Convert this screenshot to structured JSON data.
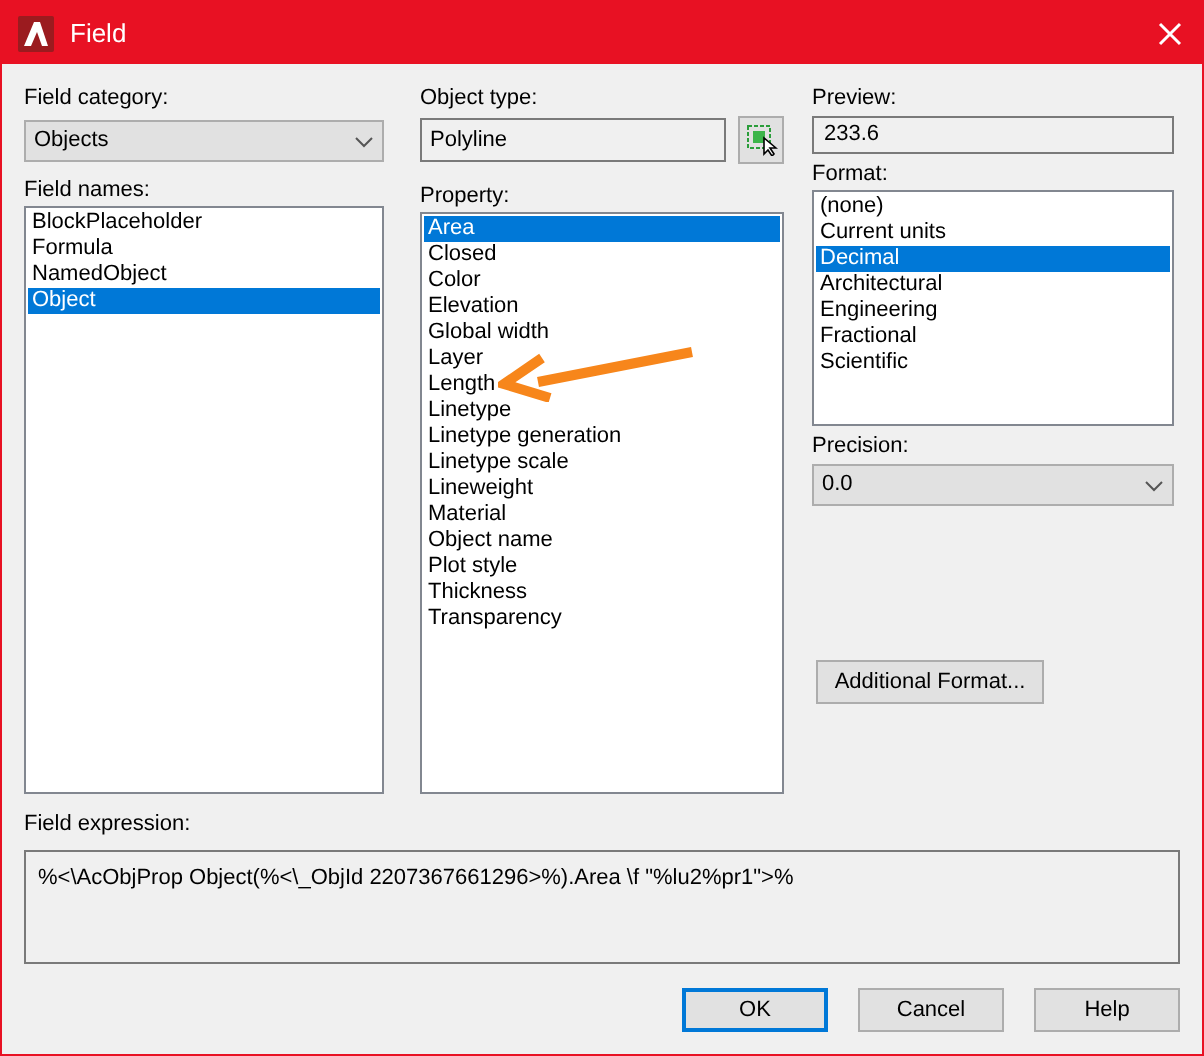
{
  "window": {
    "title": "Field"
  },
  "field_category": {
    "label": "Field category:",
    "value": "Objects"
  },
  "field_names": {
    "label": "Field names:",
    "items": [
      {
        "label": "BlockPlaceholder",
        "selected": false
      },
      {
        "label": "Formula",
        "selected": false
      },
      {
        "label": "NamedObject",
        "selected": false
      },
      {
        "label": "Object",
        "selected": true
      }
    ]
  },
  "object_type": {
    "label": "Object type:",
    "value": "Polyline"
  },
  "property": {
    "label": "Property:",
    "items": [
      {
        "label": "Area",
        "selected": true
      },
      {
        "label": "Closed",
        "selected": false
      },
      {
        "label": "Color",
        "selected": false
      },
      {
        "label": "Elevation",
        "selected": false
      },
      {
        "label": "Global width",
        "selected": false
      },
      {
        "label": "Layer",
        "selected": false
      },
      {
        "label": "Length",
        "selected": false
      },
      {
        "label": "Linetype",
        "selected": false
      },
      {
        "label": "Linetype generation",
        "selected": false
      },
      {
        "label": "Linetype scale",
        "selected": false
      },
      {
        "label": "Lineweight",
        "selected": false
      },
      {
        "label": "Material",
        "selected": false
      },
      {
        "label": "Object name",
        "selected": false
      },
      {
        "label": "Plot style",
        "selected": false
      },
      {
        "label": "Thickness",
        "selected": false
      },
      {
        "label": "Transparency",
        "selected": false
      }
    ]
  },
  "preview": {
    "label": "Preview:",
    "value": "233.6"
  },
  "format": {
    "label": "Format:",
    "items": [
      {
        "label": "(none)",
        "selected": false
      },
      {
        "label": "Current units",
        "selected": false
      },
      {
        "label": "Decimal",
        "selected": true
      },
      {
        "label": "Architectural",
        "selected": false
      },
      {
        "label": "Engineering",
        "selected": false
      },
      {
        "label": "Fractional",
        "selected": false
      },
      {
        "label": "Scientific",
        "selected": false
      }
    ]
  },
  "precision": {
    "label": "Precision:",
    "value": "0.0"
  },
  "additional_format_button": "Additional Format...",
  "field_expression": {
    "label": "Field expression:",
    "value": "%<\\AcObjProp Object(%<\\_ObjId 2207367661296>%).Area \\f \"%lu2%pr1\">%"
  },
  "buttons": [
    {
      "label": "OK",
      "default": true
    },
    {
      "label": "Cancel",
      "default": false
    },
    {
      "label": "Help",
      "default": false
    }
  ]
}
